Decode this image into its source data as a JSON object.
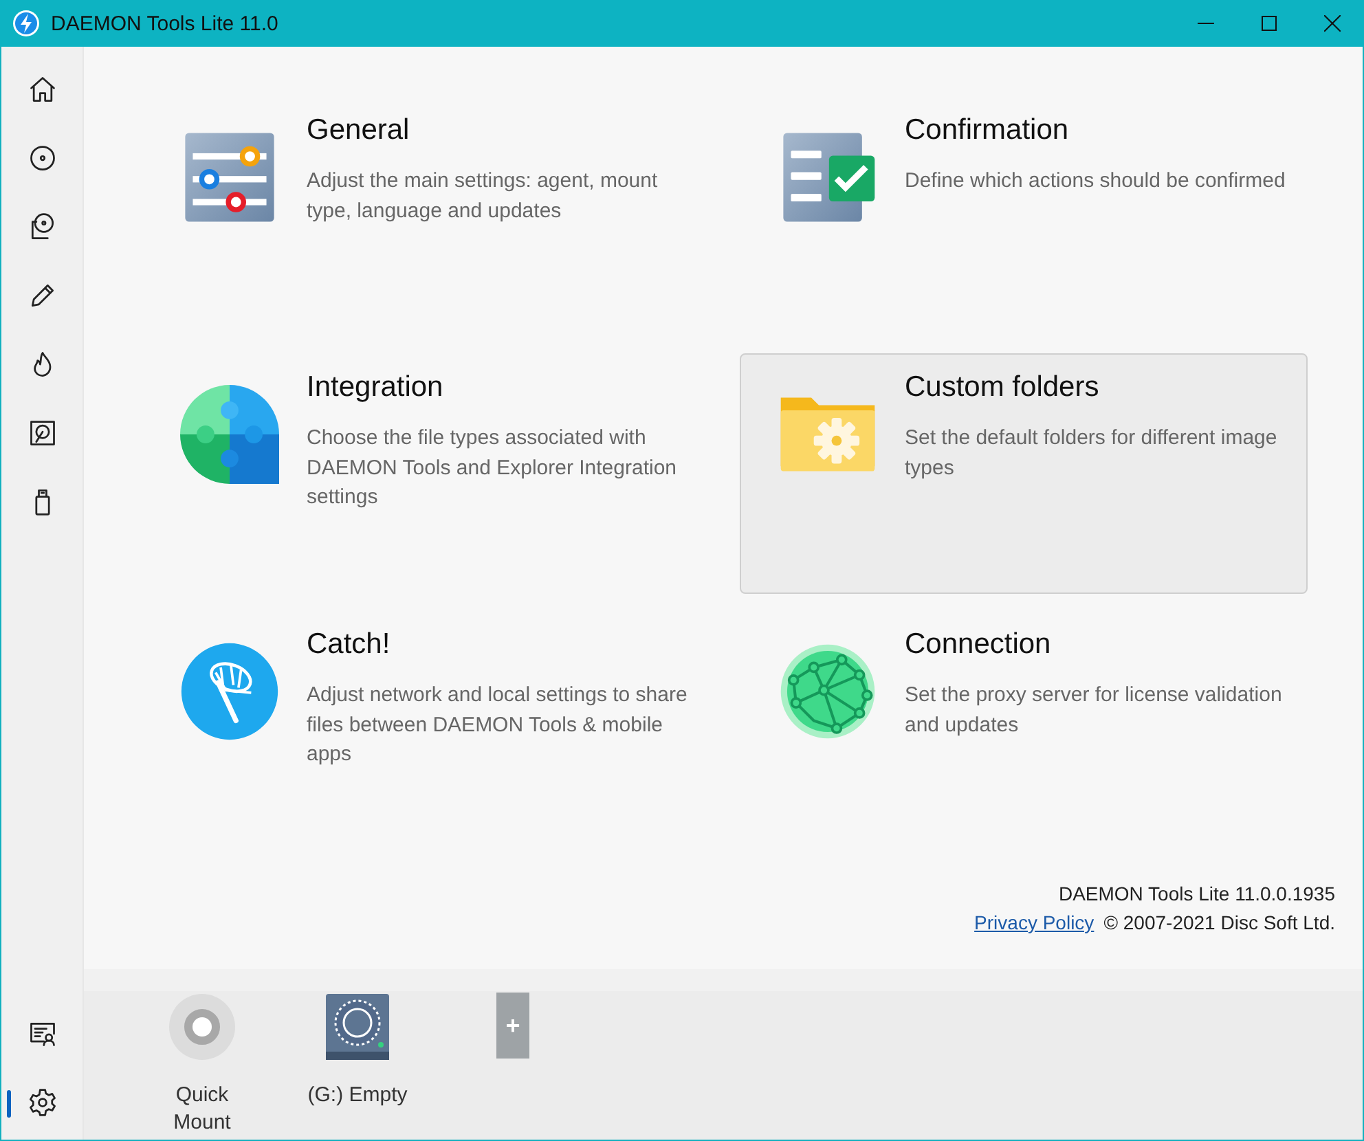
{
  "window": {
    "title": "DAEMON Tools Lite 11.0"
  },
  "sidebar": {
    "items": [
      {
        "kind": "home",
        "selected": false
      },
      {
        "kind": "disc",
        "selected": false
      },
      {
        "kind": "disc_image",
        "selected": false
      },
      {
        "kind": "pencil",
        "selected": false
      },
      {
        "kind": "flame",
        "selected": false
      },
      {
        "kind": "drive",
        "selected": false
      },
      {
        "kind": "usb",
        "selected": false
      }
    ],
    "bottom_items": [
      {
        "kind": "license",
        "selected": false
      },
      {
        "kind": "settings",
        "selected": true
      }
    ]
  },
  "cards": [
    {
      "kind": "general",
      "title": "General",
      "description": "Adjust the main settings: agent, mount type, language and updates",
      "selected": false
    },
    {
      "kind": "confirmation",
      "title": "Confirmation",
      "description": "Define which actions should be confirmed",
      "selected": false
    },
    {
      "kind": "integration",
      "title": "Integration",
      "description": "Choose the file types associated with DAEMON Tools and Explorer Integration settings",
      "selected": false
    },
    {
      "kind": "folders",
      "title": "Custom folders",
      "description": "Set the default folders for different image types",
      "selected": true
    },
    {
      "kind": "catch",
      "title": "Catch!",
      "description": "Adjust network and local settings to share files between DAEMON Tools & mobile apps",
      "selected": false
    },
    {
      "kind": "connection",
      "title": "Connection",
      "description": "Set the proxy server for license validation and updates",
      "selected": false
    }
  ],
  "footer": {
    "version": "DAEMON Tools Lite 11.0.0.1935",
    "privacy_link": "Privacy Policy",
    "copyright": "© 2007-2021 Disc Soft Ltd."
  },
  "dock": [
    {
      "kind": "quick_mount",
      "label": "Quick Mount"
    },
    {
      "kind": "drive",
      "label": "(G:) Empty"
    },
    {
      "kind": "add",
      "label": "+"
    }
  ]
}
